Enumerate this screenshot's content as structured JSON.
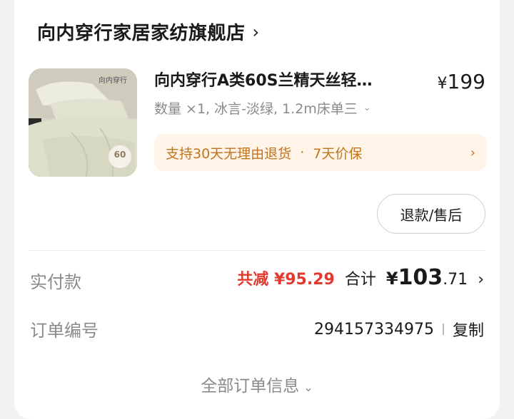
{
  "shop": {
    "name": "向内穿行家居家纺旗舰店",
    "chevron_icon": "chevron-right-icon"
  },
  "product": {
    "title": "向内穿行A类60S兰精天丝轻…",
    "price_currency": "¥",
    "price_value": "199",
    "spec": "数量 ×1, 冰言-淡绿, 1.2m床单三",
    "thumb_brand": "向内穿行",
    "thumb_badge": "60",
    "thumb_colors": {
      "bg": "#d9d6cc",
      "bedding": "#e6e6d6",
      "dark": "#2a2a2a"
    }
  },
  "guarantee": {
    "text1": "支持30天无理由退货",
    "dot": "·",
    "text2": "7天价保",
    "arrow": "›",
    "bg_color": "#fff4e7",
    "text_color": "#c0741f"
  },
  "actions": {
    "refund_label": "退款/售后"
  },
  "payment": {
    "label": "实付款",
    "discount": "共减 ¥95.29",
    "total_label": "合计",
    "total_currency": "¥",
    "total_integer": "103",
    "total_decimal": ".71",
    "discount_color": "#e23a2e"
  },
  "order": {
    "label": "订单编号",
    "number": "294157334975",
    "copy_label": "复制"
  },
  "footer": {
    "all_info_label": "全部订单信息"
  }
}
